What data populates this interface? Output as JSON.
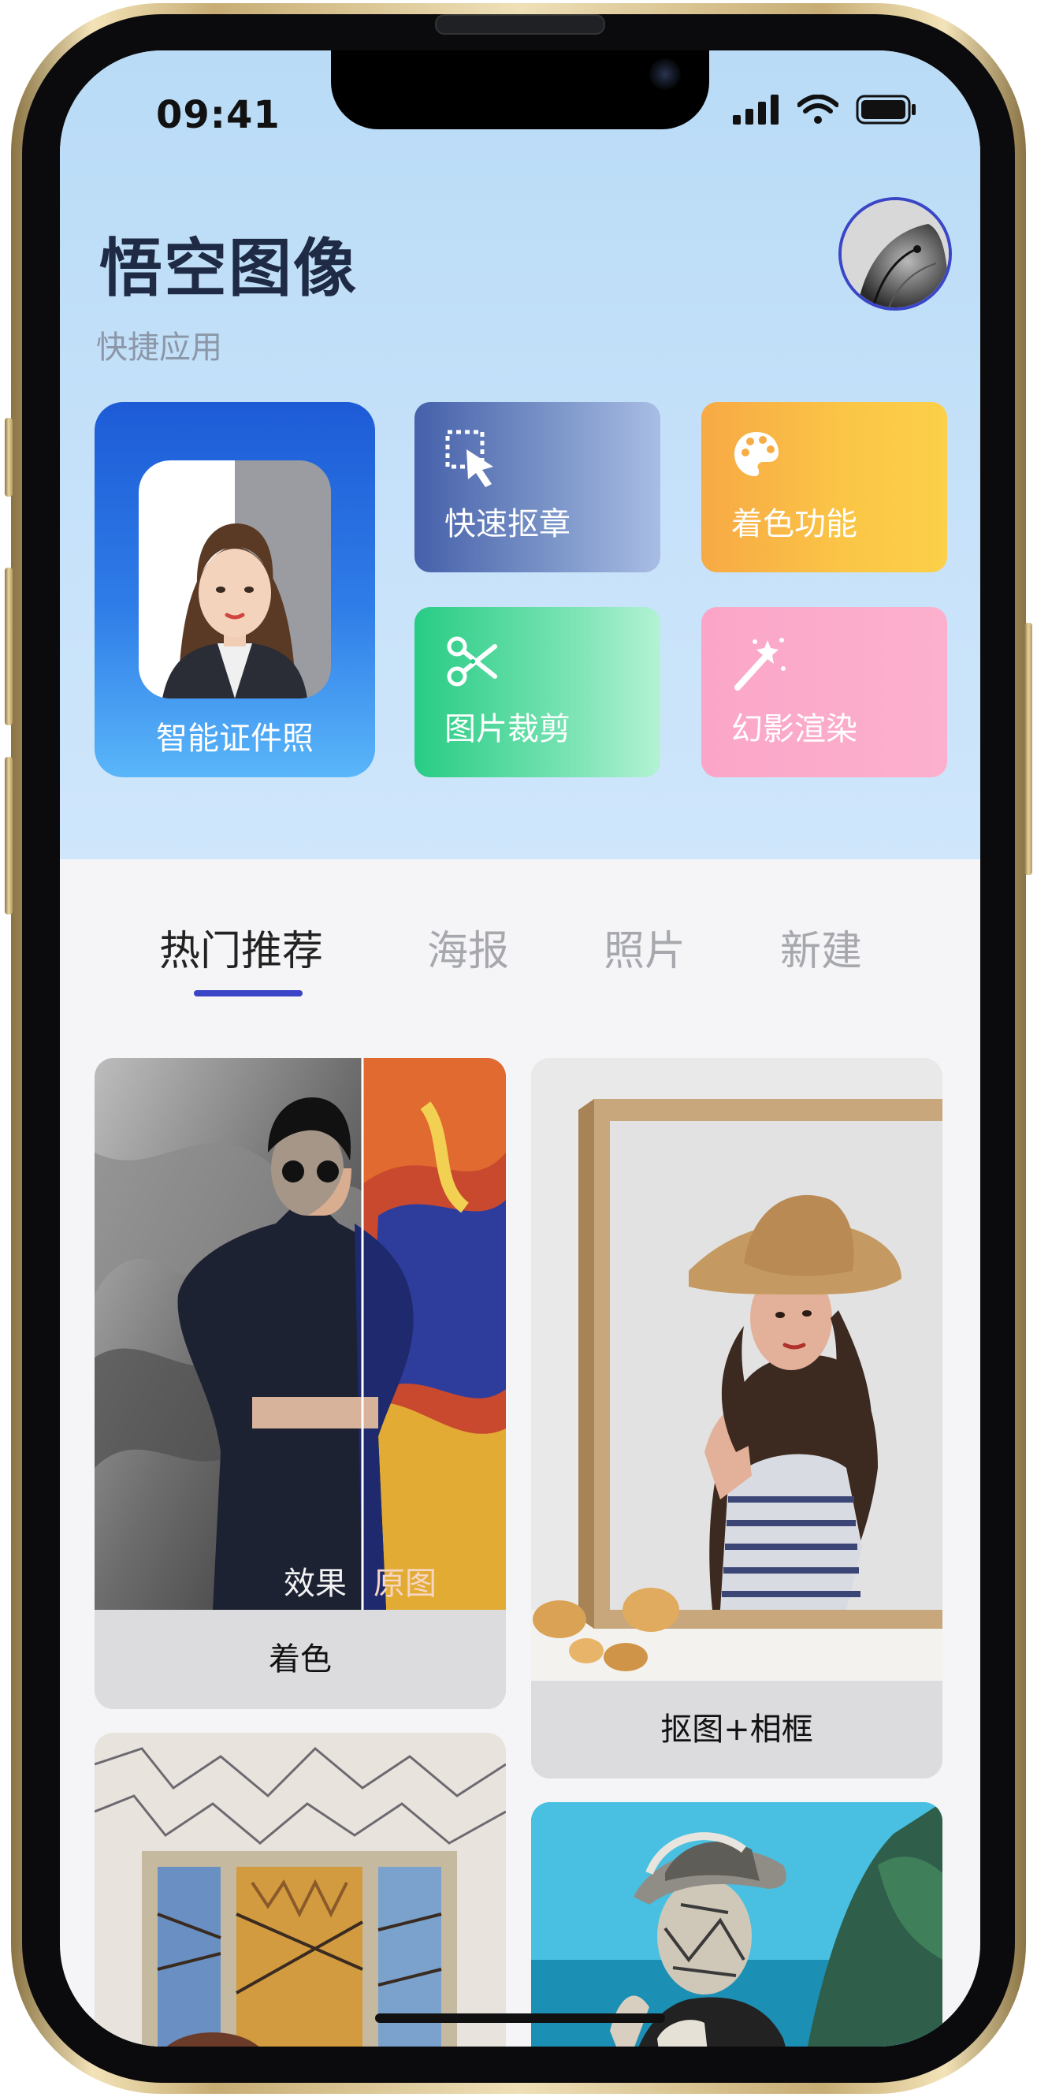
{
  "status_bar": {
    "time": "09:41"
  },
  "header": {
    "title": "悟空图像",
    "subtitle": "快捷应用"
  },
  "quick_apps": {
    "id_photo": "智能证件照",
    "items": [
      {
        "label": "快速抠章",
        "icon": "cutout-icon",
        "color": "#3e5aa5"
      },
      {
        "label": "着色功能",
        "icon": "palette-icon",
        "color": "#f6b048"
      },
      {
        "label": "图片裁剪",
        "icon": "scissors-icon",
        "color": "#2ad084"
      },
      {
        "label": "幻影渲染",
        "icon": "magic-wand-icon",
        "color": "#fcaccb"
      }
    ]
  },
  "tabs": [
    {
      "label": "热门推荐",
      "active": true
    },
    {
      "label": "海报",
      "active": false
    },
    {
      "label": "照片",
      "active": false
    },
    {
      "label": "新建",
      "active": false
    }
  ],
  "cards": [
    {
      "caption": "着色",
      "overlay_left": "效果",
      "overlay_right": "原图"
    },
    {
      "caption": "抠图+相框"
    }
  ],
  "colors": {
    "accent": "#3b43c6",
    "header_bg": "#c2dff8",
    "page_bg": "#f5f5f7"
  }
}
